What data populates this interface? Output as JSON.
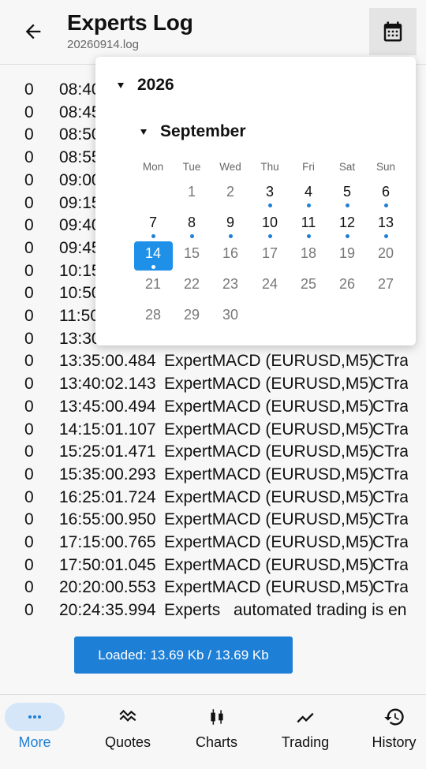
{
  "header": {
    "title": "Experts Log",
    "subtitle": "20260914.log",
    "back_icon": "arrow-left-icon",
    "calendar_icon": "calendar-icon"
  },
  "log": {
    "rows": [
      {
        "code": "0",
        "time": "08:40",
        "source": "",
        "message": ""
      },
      {
        "code": "0",
        "time": "08:45",
        "source": "",
        "message": ""
      },
      {
        "code": "0",
        "time": "08:50",
        "source": "",
        "message": ""
      },
      {
        "code": "0",
        "time": "08:55",
        "source": "",
        "message": ""
      },
      {
        "code": "0",
        "time": "09:00",
        "source": "",
        "message": ""
      },
      {
        "code": "0",
        "time": "09:15",
        "source": "",
        "message": ""
      },
      {
        "code": "0",
        "time": "09:40",
        "source": "",
        "message": ""
      },
      {
        "code": "0",
        "time": "09:45",
        "source": "",
        "message": ""
      },
      {
        "code": "0",
        "time": "10:15",
        "source": "",
        "message": ""
      },
      {
        "code": "0",
        "time": "10:50",
        "source": "",
        "message": ""
      },
      {
        "code": "0",
        "time": "11:50",
        "source": "",
        "message": ""
      },
      {
        "code": "0",
        "time": "13:30",
        "source": "",
        "message": ""
      },
      {
        "code": "0",
        "time": "13:35:00.484",
        "source": "ExpertMACD (EURUSD,M5)",
        "message": "CTra"
      },
      {
        "code": "0",
        "time": "13:40:02.143",
        "source": "ExpertMACD (EURUSD,M5)",
        "message": "CTra"
      },
      {
        "code": "0",
        "time": "13:45:00.494",
        "source": "ExpertMACD (EURUSD,M5)",
        "message": "CTra"
      },
      {
        "code": "0",
        "time": "14:15:01.107",
        "source": "ExpertMACD (EURUSD,M5)",
        "message": "CTra"
      },
      {
        "code": "0",
        "time": "15:25:01.471",
        "source": "ExpertMACD (EURUSD,M5)",
        "message": "CTra"
      },
      {
        "code": "0",
        "time": "15:35:00.293",
        "source": "ExpertMACD (EURUSD,M5)",
        "message": "CTra"
      },
      {
        "code": "0",
        "time": "16:25:01.724",
        "source": "ExpertMACD (EURUSD,M5)",
        "message": "CTra"
      },
      {
        "code": "0",
        "time": "16:55:00.950",
        "source": "ExpertMACD (EURUSD,M5)",
        "message": "CTra"
      },
      {
        "code": "0",
        "time": "17:15:00.765",
        "source": "ExpertMACD (EURUSD,M5)",
        "message": "CTra"
      },
      {
        "code": "0",
        "time": "17:50:01.045",
        "source": "ExpertMACD (EURUSD,M5)",
        "message": "CTra"
      },
      {
        "code": "0",
        "time": "20:20:00.553",
        "source": "ExpertMACD (EURUSD,M5)",
        "message": "CTra"
      },
      {
        "code": "0",
        "time": "20:24:35.994",
        "source": "Experts",
        "message": "automated trading is en"
      }
    ],
    "loaded_label": "Loaded: 13.69 Kb / 13.69 Kb"
  },
  "calendar": {
    "year": "2026",
    "month": "September",
    "weekdays": [
      "Mon",
      "Tue",
      "Wed",
      "Thu",
      "Fri",
      "Sat",
      "Sun"
    ],
    "first_weekday_index": 1,
    "days_in_month": 30,
    "selected_day": 14,
    "days_with_logs": [
      3,
      4,
      5,
      6,
      7,
      8,
      9,
      10,
      11,
      12,
      13,
      14
    ]
  },
  "bottom_nav": {
    "active_index": 0,
    "items": [
      {
        "label": "More",
        "icon": "more-dots-icon"
      },
      {
        "label": "Quotes",
        "icon": "quotes-icon"
      },
      {
        "label": "Charts",
        "icon": "candlestick-icon"
      },
      {
        "label": "Trading",
        "icon": "trend-line-icon"
      },
      {
        "label": "History",
        "icon": "history-clock-icon"
      }
    ]
  },
  "colors": {
    "accent": "#1e7fd6",
    "selected_day": "#1e90e8",
    "nav_active_bg": "#d5e6f8"
  }
}
